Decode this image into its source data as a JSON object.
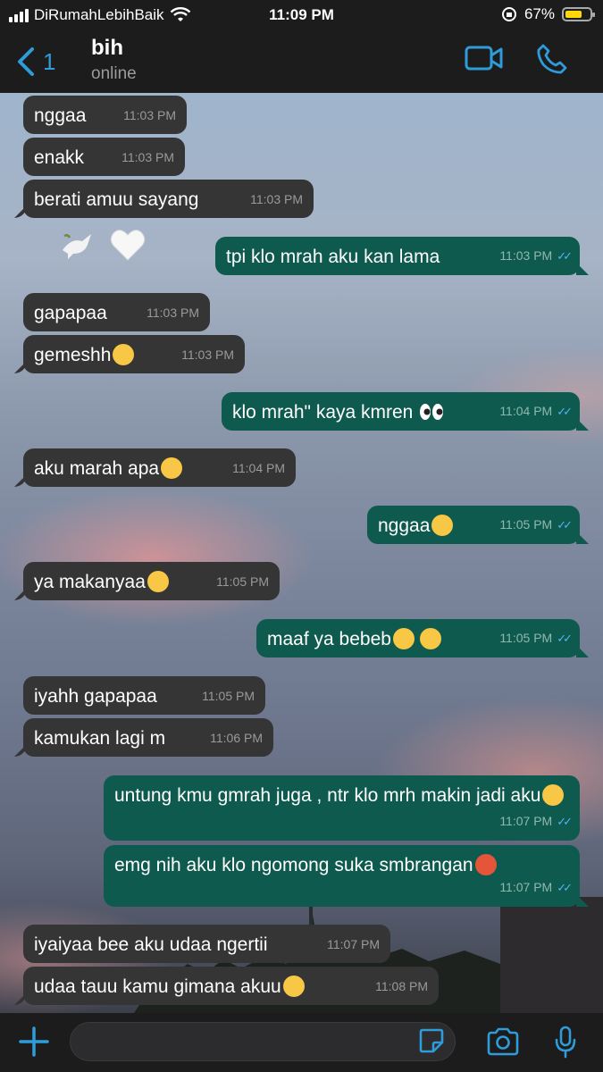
{
  "status_bar": {
    "carrier": "DiRumahLebihBaik",
    "time": "11:09 PM",
    "battery_percent": "67%"
  },
  "header": {
    "back_count": "1",
    "contact_name": "bih",
    "contact_status": "online"
  },
  "colors": {
    "accent": "#2f9bd8",
    "incoming_bubble": "#353536",
    "outgoing_bubble": "#0f5a4e",
    "read_tick": "#4fb3f2"
  },
  "messages": [
    {
      "dir": "in",
      "text": "nggaa",
      "time": "11:03 PM"
    },
    {
      "dir": "in",
      "text": "enakk",
      "time": "11:03 PM"
    },
    {
      "dir": "in",
      "text": "berati amuu sayang",
      "time": "11:03 PM"
    },
    {
      "dir": "out",
      "text": "tpi klo mrah aku kan lama",
      "time": "11:03 PM"
    },
    {
      "dir": "in",
      "text": "gapapaa",
      "time": "11:03 PM"
    },
    {
      "dir": "in",
      "text": "gemeshh",
      "emoji": "kissing-face-icon",
      "time": "11:03 PM"
    },
    {
      "dir": "out",
      "text": "klo mrah\" kaya kmren",
      "emoji": "eyes-icon",
      "time": "11:04 PM"
    },
    {
      "dir": "in",
      "text": "aku marah apa",
      "emoji": "relieved-face-icon",
      "time": "11:04 PM"
    },
    {
      "dir": "out",
      "text": "nggaa",
      "emoji": "pleading-face-icon",
      "time": "11:05 PM"
    },
    {
      "dir": "in",
      "text": "ya makanyaa",
      "emoji": "smirk-face-icon",
      "time": "11:05 PM"
    },
    {
      "dir": "out",
      "text": "maaf ya bebeb",
      "emoji": "frowning-hugging-icons",
      "time": "11:05 PM"
    },
    {
      "dir": "in",
      "text": "iyahh gapapaa",
      "time": "11:05 PM"
    },
    {
      "dir": "in",
      "text": "kamukan lagi m",
      "time": "11:06 PM"
    },
    {
      "dir": "out",
      "text": "untung kmu gmrah juga , ntr klo mrh makin jadi aku",
      "emoji": "confused-face-icon",
      "time": "11:07 PM"
    },
    {
      "dir": "out",
      "text": "emg nih aku klo ngomong suka smbrangan",
      "emoji": "cursing-face-icon",
      "time": "11:07 PM"
    },
    {
      "dir": "in",
      "text": "iyaiyaa bee aku udaa ngertii",
      "time": "11:07 PM"
    },
    {
      "dir": "in",
      "text": "udaa tauu kamu gimana akuu",
      "emoji": "eye-roll-face-icon",
      "time": "11:08 PM"
    }
  ],
  "stickers": [
    "dove-icon",
    "white-heart-icon"
  ],
  "composer": {
    "placeholder": ""
  }
}
